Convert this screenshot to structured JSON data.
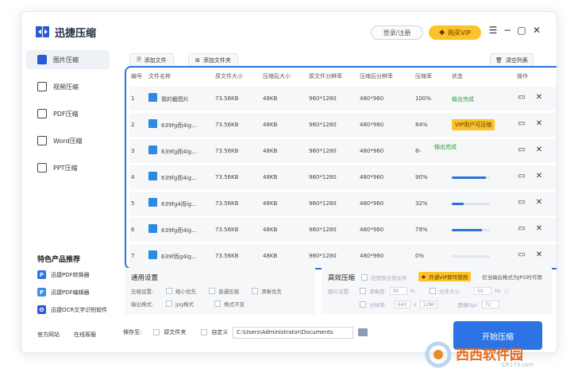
{
  "app": {
    "title": "迅捷压缩",
    "login_label": "登录/注册",
    "vip_label": "购买VIP",
    "accent": "#2c73d8",
    "vip_color": "#fbc229"
  },
  "sidebar": {
    "items": [
      {
        "label": "图片压缩",
        "icon": "image-icon",
        "active": true
      },
      {
        "label": "视频压缩",
        "icon": "video-icon",
        "active": false
      },
      {
        "label": "PDF压缩",
        "icon": "pdf-icon",
        "active": false
      },
      {
        "label": "Word压缩",
        "icon": "word-icon",
        "active": false
      },
      {
        "label": "PPT压缩",
        "icon": "ppt-icon",
        "active": false
      }
    ],
    "products_title": "特色产品推荐",
    "products": [
      {
        "label": "迅捷PDF转换器",
        "icon": "P",
        "color": "#2c73e6"
      },
      {
        "label": "迅捷PDF编辑器",
        "icon": "P",
        "color": "#3a8ee6"
      },
      {
        "label": "迅捷OCR文字识别软件",
        "icon": "O",
        "color": "#2a5bd7"
      }
    ],
    "footer": {
      "website": "官方网站",
      "service": "在线客服"
    }
  },
  "toolbar": {
    "add_file": "添加文件",
    "add_folder": "添加文件夹",
    "clear_list": "清空列表"
  },
  "table": {
    "headers": [
      "编号",
      "文件名称",
      "原文件大小",
      "压缩后大小",
      "原文件分辨率",
      "压缩后分辨率",
      "压缩率",
      "状态",
      "操作"
    ],
    "rows": [
      {
        "num": "1",
        "name": "我的截图片",
        "orig_size": "73.56KB",
        "new_size": "48KB",
        "orig_res": "960*1280",
        "new_res": "480*960",
        "rate": "100%",
        "status_type": "done",
        "status": "输出完成",
        "progress": 1.0
      },
      {
        "num": "2",
        "name": "639fg而4ig...",
        "orig_size": "73.56KB",
        "new_size": "48KB",
        "orig_res": "960*1280",
        "new_res": "480*960",
        "rate": "84%",
        "status_type": "vip",
        "status": "VIP用户可压缩",
        "progress": 0.84
      },
      {
        "num": "3",
        "name": "639fg而4ig...",
        "orig_size": "73.56KB",
        "new_size": "48KB",
        "orig_res": "960*1280",
        "new_res": "480*960",
        "rate": "8‹",
        "status_type": "done-shift",
        "status": "输出完成",
        "progress": 0.84
      },
      {
        "num": "4",
        "name": "639fg而4ig...",
        "orig_size": "73.56KB",
        "new_size": "48KB",
        "orig_res": "960*1280",
        "new_res": "480*960",
        "rate": "90%",
        "status_type": "progress",
        "status": "",
        "progress": 0.9
      },
      {
        "num": "5",
        "name": "639fg4而ig...",
        "orig_size": "73.56KB",
        "new_size": "48KB",
        "orig_res": "960*1280",
        "new_res": "480*960",
        "rate": "32%",
        "status_type": "progress",
        "status": "",
        "progress": 0.32
      },
      {
        "num": "6",
        "name": "639fg而4ig...",
        "orig_size": "73.56KB",
        "new_size": "48KB",
        "orig_res": "960*1280",
        "new_res": "480*960",
        "rate": "79%",
        "status_type": "progress",
        "status": "",
        "progress": 0.79
      },
      {
        "num": "7",
        "name": "639f而g4ig...",
        "orig_size": "73.56KB",
        "new_size": "48KB",
        "orig_res": "960*1280",
        "new_res": "480*960",
        "rate": "0%",
        "status_type": "progress",
        "status": "",
        "progress": 0.0
      }
    ]
  },
  "general": {
    "title": "通用设置",
    "mode_label": "压缩设置:",
    "modes": [
      "缩小优先",
      "普通压缩",
      "清晰优先"
    ],
    "format_label": "输出格式:",
    "formats": [
      "jpg格式",
      "格式不变"
    ]
  },
  "advanced": {
    "title": "高效压缩",
    "apply_all": "应用到全部文件",
    "vip_tag": "开通VIP即可使用",
    "note": "仅当输出格式为JPG时可用",
    "img_quality": "图片设置:",
    "clarity": "清晰度:",
    "clarity_value": "90",
    "file_size": "文件大小:",
    "file_size_value": "50",
    "file_size_unit": "kb",
    "resolution": "分辨率:",
    "res_w": "640",
    "res_h": "1280",
    "dpi": "图像Dpi:",
    "dpi_value": "72"
  },
  "bottom": {
    "save_to": "保存至:",
    "orig_folder": "原文件夹",
    "custom": "自定义",
    "path": "C:\\Users\\Administrator\\Documents",
    "start": "开始压缩"
  },
  "watermark": {
    "brand": "西西软件园",
    "site": "CR173.com"
  }
}
